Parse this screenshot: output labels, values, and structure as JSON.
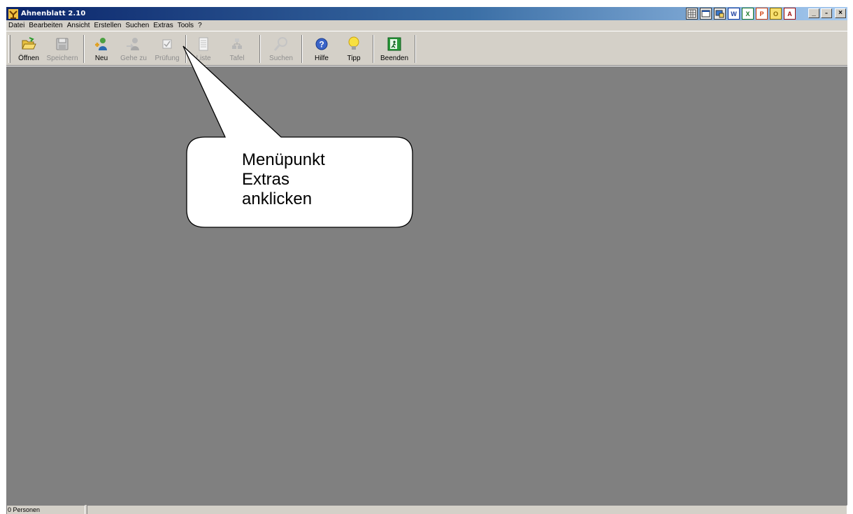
{
  "window": {
    "title": "Ahnenblatt 2.10",
    "controls": [
      "_",
      "̵",
      "×"
    ]
  },
  "tray_icons": [
    "grid-icon",
    "window-icon",
    "monitor-icon",
    "W",
    "X",
    "P",
    "O",
    "A"
  ],
  "menu": [
    "Datei",
    "Bearbeiten",
    "Ansicht",
    "Erstellen",
    "Suchen",
    "Extras",
    "Tools",
    "?"
  ],
  "toolbar": {
    "buttons": [
      {
        "label": "Öffnen",
        "icon": "folder-open-icon",
        "enabled": true
      },
      {
        "label": "Speichern",
        "icon": "floppy-disk-icon",
        "enabled": false
      },
      {
        "label": "Neu",
        "icon": "new-person-icon",
        "enabled": true
      },
      {
        "label": "Gehe zu",
        "icon": "goto-person-icon",
        "enabled": false
      },
      {
        "label": "Prüfung",
        "icon": "check-icon",
        "enabled": false
      },
      {
        "label": "Liste",
        "icon": "list-icon",
        "enabled": false
      },
      {
        "label": "Tafel",
        "icon": "tree-chart-icon",
        "enabled": false
      },
      {
        "label": "Suchen",
        "icon": "magnifier-icon",
        "enabled": false
      },
      {
        "label": "Hilfe",
        "icon": "help-icon",
        "enabled": true
      },
      {
        "label": "Tipp",
        "icon": "lightbulb-icon",
        "enabled": true
      },
      {
        "label": "Beenden",
        "icon": "exit-icon",
        "enabled": true
      }
    ]
  },
  "status": {
    "persons": "0 Personen",
    "info": ""
  },
  "callout": {
    "lines": [
      "Menüpunkt",
      "Extras",
      "anklicken"
    ]
  },
  "colors": {
    "title_start": "#0a246a",
    "title_end": "#a6caf0",
    "chrome": "#d4d0c8",
    "workspace": "#808080"
  }
}
